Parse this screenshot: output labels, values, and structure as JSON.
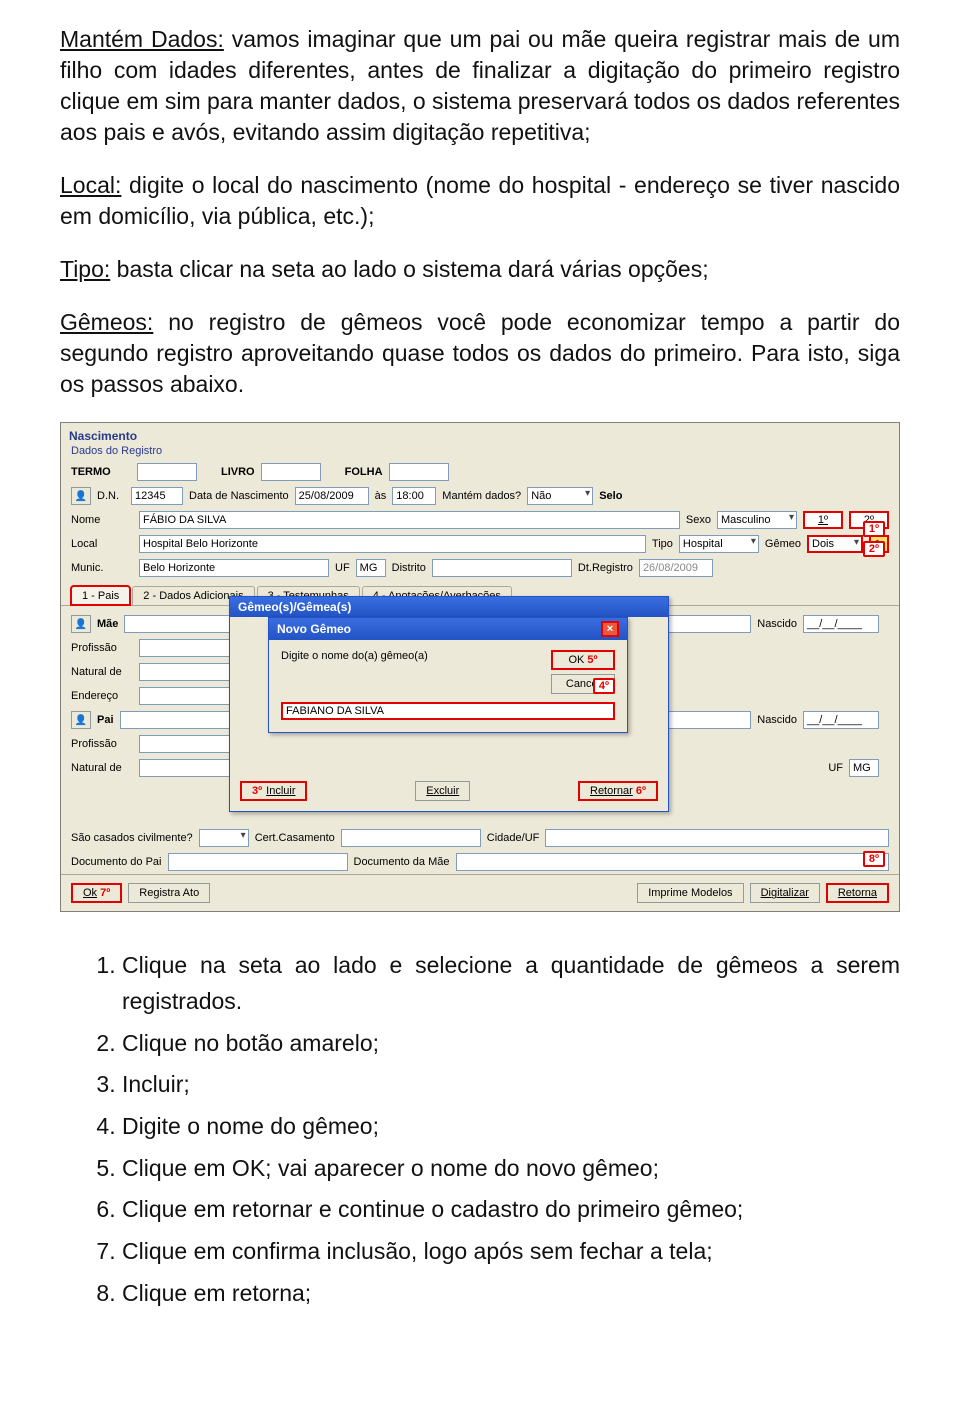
{
  "paragraphs": {
    "p1_label": "Mantém Dados:",
    "p1_rest": " vamos imaginar que um pai ou mãe queira registrar mais de um filho com idades diferentes, antes de finalizar a digitação do primeiro registro clique em sim para manter dados, o sistema preservará todos os dados referentes aos pais e avós, evitando assim digitação repetitiva;",
    "p2_label": "Local:",
    "p2_rest": " digite o local do nascimento (nome do hospital - endereço se tiver nascido em domicílio, via pública, etc.);",
    "p3_label": "Tipo:",
    "p3_rest": " basta clicar na seta ao lado o sistema dará várias opções;",
    "p4_label": "Gêmeos:",
    "p4_rest": " no registro de gêmeos você pode economizar tempo a partir do segundo registro aproveitando quase todos os dados do primeiro. Para isto, siga os passos abaixo."
  },
  "shot": {
    "title": "Nascimento",
    "group": "Dados do Registro",
    "termo": "TERMO",
    "livro": "LIVRO",
    "folha": "FOLHA",
    "dn": "D.N.",
    "dn_val": "12345",
    "datanasc": "Data de Nascimento",
    "datanasc_val": "25/08/2009",
    "as": "às",
    "as_val": "18:00",
    "mantem": "Mantém dados?",
    "mantem_val": "Não",
    "selo": "Selo",
    "nome": "Nome",
    "nome_val": "FÁBIO DA SILVA",
    "sexo": "Sexo",
    "sexo_val": "Masculino",
    "um": "1º",
    "dois": "2º",
    "local": "Local",
    "local_val": "Hospital Belo Horizonte",
    "tipo": "Tipo",
    "tipo_val": "Hospital",
    "gemeo": "Gêmeo",
    "gemeo_val": "Dois",
    "munic": "Munic.",
    "munic_val": "Belo Horizonte",
    "uf": "UF",
    "uf_val": "MG",
    "distrito": "Distrito",
    "dtreg": "Dt.Registro",
    "dtreg_val": "26/08/2009",
    "tabs": [
      "1 - Pais",
      "2 - Dados Adicionais",
      "3 - Testemunhas",
      "4 - Anotações/Averbações"
    ],
    "mae": "Mãe",
    "pai": "Pai",
    "profissao": "Profissão",
    "natural": "Natural de",
    "endereco": "Endereço",
    "nascido": "Nascido",
    "datemask": "__/__/____",
    "casados": "São casados civilmente?",
    "certcas": "Cert.Casamento",
    "cidadeuf": "Cidade/UF",
    "docpai": "Documento do Pai",
    "docmae": "Documento da Mãe",
    "ok": "Ok",
    "regato": "Registra Ato",
    "impmod": "Imprime Modelos",
    "digitalizar": "Digitalizar",
    "retorna": "Retorna",
    "dlg_outer_title": "Gêmeo(s)/Gêmea(s)",
    "dlg_inner_title": "Novo Gêmeo",
    "dlg_prompt": "Digite o nome do(a) gêmeo(a)",
    "dlg_ok": "OK",
    "dlg_cancel": "Cancel",
    "dlg_name_val": "FABIANO DA SILVA",
    "incluir": "Incluir",
    "excluir": "Excluir",
    "retornar": "Retornar",
    "b1": "1º",
    "b2": "2º",
    "b3": "3º",
    "b4": "4º",
    "b5": "5º",
    "b6": "6º",
    "b7": "7º",
    "b8": "8º"
  },
  "list": [
    "Clique na seta ao lado e selecione a quantidade de gêmeos a serem registrados.",
    "Clique no botão amarelo;",
    "Incluir;",
    "Digite o nome do gêmeo;",
    "Clique em OK; vai aparecer o nome do novo gêmeo;",
    "Clique em retornar e continue o cadastro do primeiro gêmeo;",
    "Clique em confirma inclusão, logo após sem fechar a tela;",
    "Clique em retorna;"
  ]
}
